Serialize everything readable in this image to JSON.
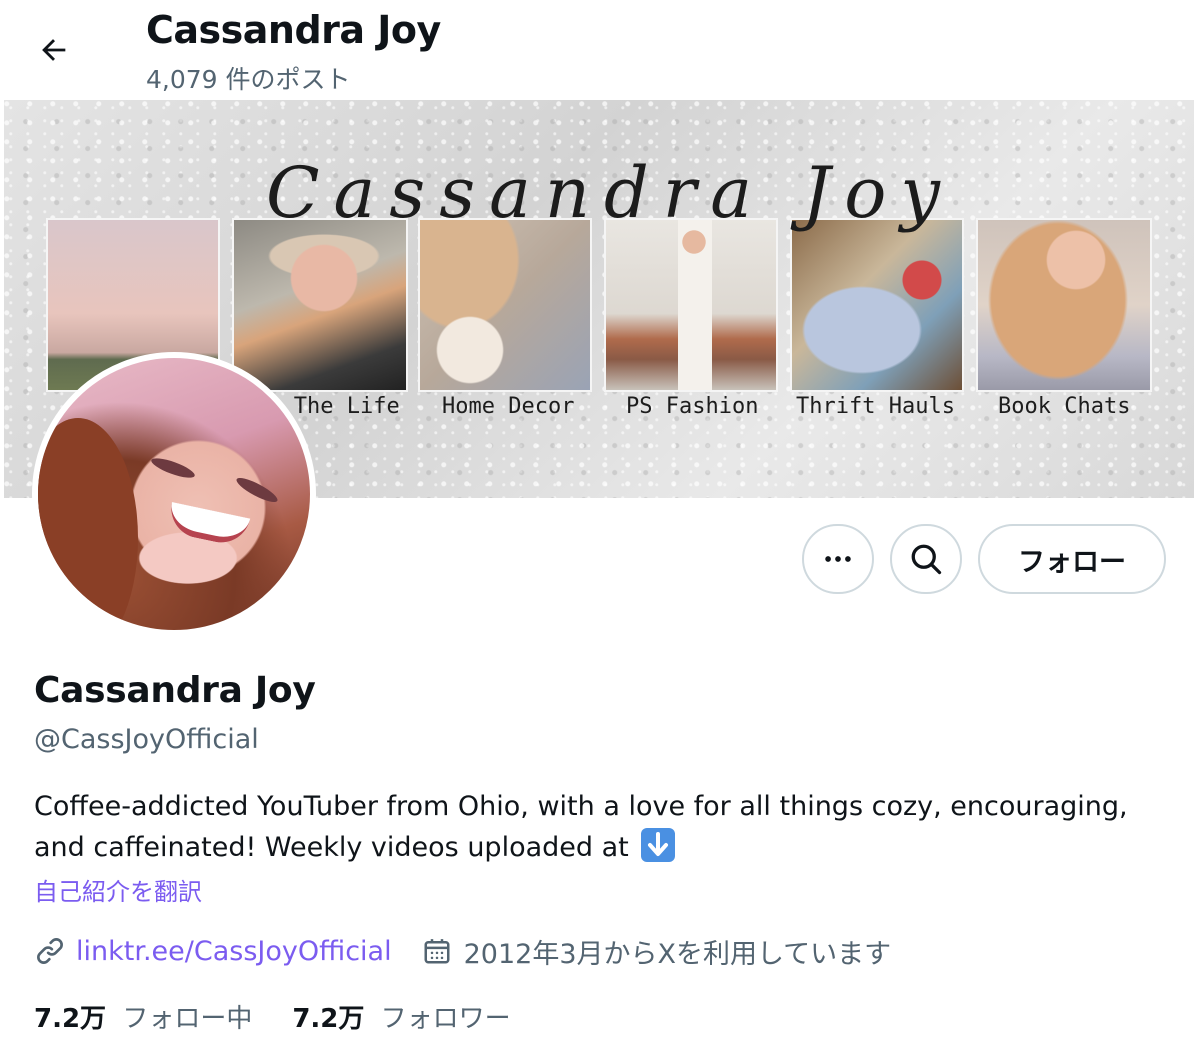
{
  "header": {
    "title": "Cassandra Joy",
    "post_count": "4,079 件のポスト"
  },
  "banner": {
    "script_text": "Cassandra Joy",
    "tiles": [
      {
        "label": ""
      },
      {
        "label": "In The Life"
      },
      {
        "label": "Home Decor"
      },
      {
        "label": "PS Fashion"
      },
      {
        "label": "Thrift Hauls"
      },
      {
        "label": "Book Chats"
      }
    ]
  },
  "actions": {
    "more_icon": "more-horizontal-icon",
    "search_icon": "search-icon",
    "follow_label": "フォロー"
  },
  "profile": {
    "name": "Cassandra Joy",
    "handle": "@CassJoyOfficial",
    "bio": "Coffee-addicted YouTuber from Ohio, with a love for all things cozy, encouraging, and caffeinated! Weekly videos uploaded at",
    "bio_emoji": "down-arrow-emoji",
    "translate_label": "自己紹介を翻訳",
    "link_text": "linktr.ee/CassJoyOfficial",
    "joined_text": "2012年3月からXを利用しています",
    "following_count": "7.2万",
    "following_label": "フォロー中",
    "followers_count": "7.2万",
    "followers_label": "フォロワー"
  },
  "colors": {
    "text": "#0f1419",
    "secondary": "#536471",
    "link": "#7b5cf0",
    "border": "#cfd9de"
  }
}
